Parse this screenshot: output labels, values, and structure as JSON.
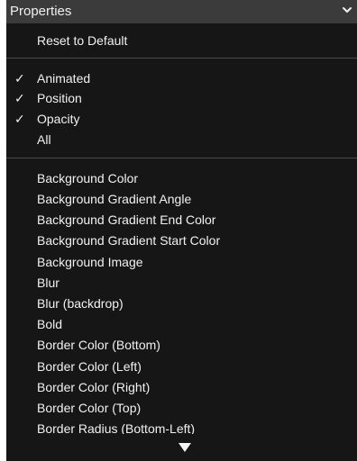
{
  "header": {
    "title": "Properties",
    "chevron_icon": "chevron-down-icon"
  },
  "reset": {
    "label": "Reset to Default"
  },
  "toggles": [
    {
      "label": "Animated",
      "checked": true,
      "check_mark": "✓"
    },
    {
      "label": "Position",
      "checked": true,
      "check_mark": "✓"
    },
    {
      "label": "Opacity",
      "checked": true,
      "check_mark": "✓"
    },
    {
      "label": "All",
      "checked": false,
      "check_mark": ""
    }
  ],
  "properties": [
    "Background Color",
    "Background Gradient Angle",
    "Background Gradient End Color",
    "Background Gradient Start Color",
    "Background Image",
    "Blur",
    "Blur (backdrop)",
    "Bold",
    "Border Color (Bottom)",
    "Border Color (Left)",
    "Border Color (Right)",
    "Border Color (Top)",
    "Border Radius (Bottom-Left)"
  ],
  "scroll": {
    "icon": "scroll-down-arrow-icon"
  },
  "colors": {
    "menu_background": "#161616",
    "header_background": "#3b3b3b",
    "text": "#f1f1f1",
    "separator": "#4a4a4a"
  }
}
